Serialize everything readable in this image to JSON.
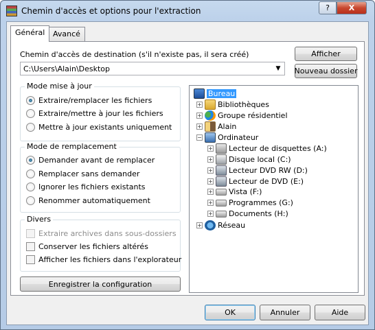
{
  "window": {
    "title": "Chemin d'accès et options pour l'extraction",
    "help_label": "?",
    "close_label": "X"
  },
  "tabs": [
    {
      "label": "Général"
    },
    {
      "label": "Avancé"
    }
  ],
  "destination": {
    "label": "Chemin d'accès de destination (s'il n'existe pas, il sera créé)",
    "value": "C:\\Users\\Alain\\Desktop"
  },
  "buttons": {
    "show": "Afficher",
    "new_folder": "Nouveau dossier",
    "save_config": "Enregistrer la configuration",
    "ok": "OK",
    "cancel": "Annuler",
    "help": "Aide"
  },
  "update_mode": {
    "title": "Mode mise à jour",
    "options": [
      "Extraire/remplacer les fichiers",
      "Extraire/mettre à jour les fichiers",
      "Mettre à jour existants uniquement"
    ],
    "selected": 0
  },
  "overwrite_mode": {
    "title": "Mode de remplacement",
    "options": [
      "Demander avant de remplacer",
      "Remplacer sans demander",
      "Ignorer les fichiers existants",
      "Renommer automatiquement"
    ],
    "selected": 0
  },
  "misc": {
    "title": "Divers",
    "options": [
      {
        "label": "Extraire archives dans sous-dossiers",
        "checked": false,
        "enabled": false
      },
      {
        "label": "Conserver les fichiers altérés",
        "checked": false,
        "enabled": true
      },
      {
        "label": "Afficher les fichiers dans l'explorateur",
        "checked": false,
        "enabled": true
      }
    ]
  },
  "tree": {
    "nodes": [
      {
        "label": "Bureau",
        "icon": "desktop-icon",
        "selected": true
      },
      {
        "label": "Bibliothèques",
        "icon": "libraries-icon"
      },
      {
        "label": "Groupe résidentiel",
        "icon": "homegroup-icon"
      },
      {
        "label": "Alain",
        "icon": "user-folder-icon"
      },
      {
        "label": "Ordinateur",
        "icon": "computer-icon"
      },
      {
        "label": "Lecteur de disquettes (A:)",
        "icon": "floppy-drive-icon"
      },
      {
        "label": "Disque local (C:)",
        "icon": "local-disk-icon"
      },
      {
        "label": "Lecteur DVD RW (D:)",
        "icon": "dvd-rw-drive-icon"
      },
      {
        "label": "Lecteur de DVD (E:)",
        "icon": "dvd-drive-icon"
      },
      {
        "label": "Vista (F:)",
        "icon": "drive-icon"
      },
      {
        "label": "Programmes (G:)",
        "icon": "drive-icon"
      },
      {
        "label": "Documents (H:)",
        "icon": "drive-icon"
      },
      {
        "label": "Réseau",
        "icon": "network-icon"
      }
    ]
  }
}
